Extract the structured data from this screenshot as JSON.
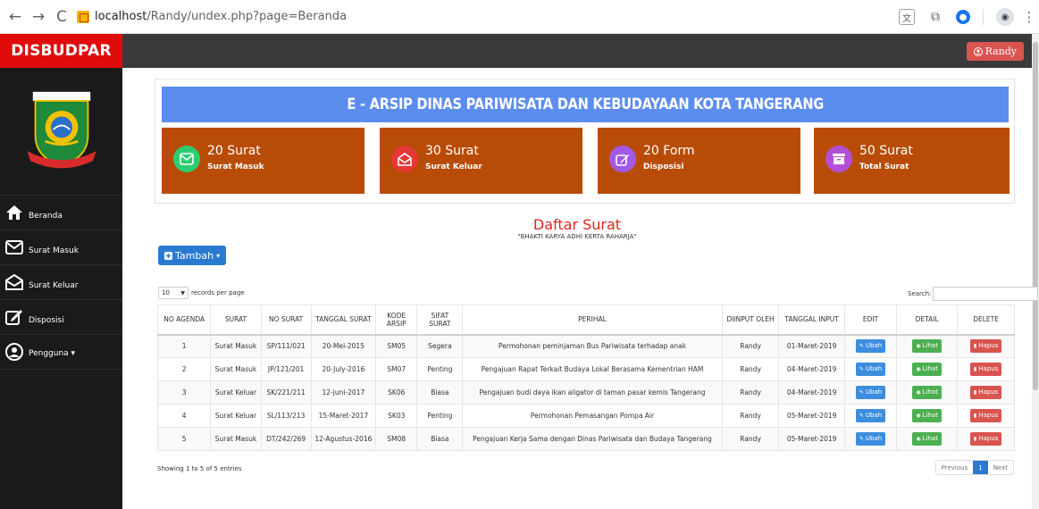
{
  "browser": {
    "url_host": "localhost",
    "url_path": "/Randy/undex.php?page=Beranda",
    "profile_initials": ""
  },
  "sidebar": {
    "brand": "DISBUDPAR",
    "logo_text_top": "KOTA TANGERANG",
    "logo_text_bottom": "BHAKTI KARYA ADHI KERTA RAHARJA",
    "items": [
      {
        "label": "Beranda",
        "icon": "home-icon"
      },
      {
        "label": "Surat Masuk",
        "icon": "envelope-icon"
      },
      {
        "label": "Surat Keluar",
        "icon": "envelope-open-icon"
      },
      {
        "label": "Disposisi",
        "icon": "edit-icon"
      },
      {
        "label": "Pengguna ▾",
        "icon": "user-icon"
      }
    ]
  },
  "header": {
    "user_label": "Randy"
  },
  "banner": {
    "title": "E - ARSIP DINAS PARIWISATA DAN KEBUDAYAAN KOTA TANGERANG"
  },
  "stats": [
    {
      "value": "20 Surat",
      "label": "Surat Masuk",
      "icon": "envelope-icon",
      "color": "#2ecc71"
    },
    {
      "value": "30 Surat",
      "label": "Surat Keluar",
      "icon": "envelope-open-icon",
      "color": "#e53935"
    },
    {
      "value": "20 Form",
      "label": "Disposisi",
      "icon": "edit-icon",
      "color": "#a259e6"
    },
    {
      "value": "50 Surat",
      "label": "Total Surat",
      "icon": "archive-icon",
      "color": "#b24fd6"
    }
  ],
  "main": {
    "title": "Daftar Surat",
    "subtitle": "\"BHAKTI KARYA ADHI KERTA RAHARJA\"",
    "add_button": "Tambah",
    "records_value": "10",
    "records_suffix": "records per page",
    "search_label": "Search:",
    "showing": "Showing 1 to 5 of 5 entries",
    "pager": {
      "previous": "Previous",
      "current": "1",
      "next": "Next"
    }
  },
  "table": {
    "headers": [
      "NO AGENDA",
      "SURAT",
      "NO SURAT",
      "TANGGAL SURAT",
      "KODE ARSIP",
      "SIFAT SURAT",
      "PERIHAL",
      "DIINPUT OLEH",
      "TANGGAL INPUT",
      "EDIT",
      "DETAIL",
      "DELETE"
    ],
    "action_labels": {
      "edit": "Ubah",
      "detail": "Lihat",
      "delete": "Hapus"
    },
    "rows": [
      [
        "1",
        "Surat Masuk",
        "SP/111/021",
        "20-Mei-2015",
        "SM05",
        "Segera",
        "Permohonan peminjaman Bus Pariwisata terhadap anak",
        "Randy",
        "01-Maret-2019"
      ],
      [
        "2",
        "Surat Masuk",
        "JP/121/201",
        "20-July-2016",
        "SM07",
        "Penting",
        "Pengajuan Rapat Terkait Budaya Lokal Berasama Kementrian HAM",
        "Randy",
        "04-Maret-2019"
      ],
      [
        "3",
        "Surat Keluar",
        "SK/221/211",
        "12-juni-2017",
        "SK06",
        "Biasa",
        "Pengajuan budi daya ikan aligator di taman pasar kemis Tangerang",
        "Randy",
        "04-Maret-2019"
      ],
      [
        "4",
        "Surat Keluar",
        "SL/113/213",
        "15-Maret-2017",
        "SK03",
        "Penting",
        "Permohonan Pemasangan Pompa Air",
        "Randy",
        "05-Maret-2019"
      ],
      [
        "5",
        "Surat Masuk",
        "DT/242/269",
        "12-Agustus-2016",
        "SM08",
        "Biasa",
        "Pengajuan Kerja Sama dengan Dinas Pariwisata dan Budaya Tangerang",
        "Randy",
        "05-Maret-2019"
      ]
    ]
  }
}
